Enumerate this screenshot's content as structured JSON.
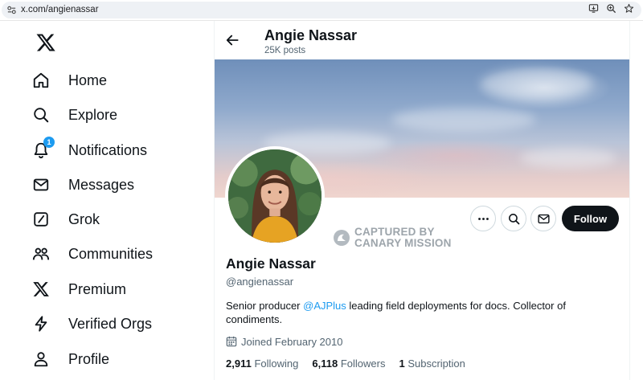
{
  "browser": {
    "url": "x.com/angienassar"
  },
  "nav": {
    "items": [
      {
        "label": "Home",
        "icon": "home-icon"
      },
      {
        "label": "Explore",
        "icon": "search-icon"
      },
      {
        "label": "Notifications",
        "icon": "bell-icon",
        "badge": "1"
      },
      {
        "label": "Messages",
        "icon": "envelope-icon"
      },
      {
        "label": "Grok",
        "icon": "grok-icon"
      },
      {
        "label": "Communities",
        "icon": "people-icon"
      },
      {
        "label": "Premium",
        "icon": "x-logo-icon"
      },
      {
        "label": "Verified Orgs",
        "icon": "lightning-icon"
      },
      {
        "label": "Profile",
        "icon": "person-icon"
      }
    ]
  },
  "header": {
    "name": "Angie Nassar",
    "posts": "25K posts"
  },
  "profile": {
    "name": "Angie Nassar",
    "handle": "@angienassar",
    "bio_before": "Senior producer ",
    "bio_mention": "@AJPlus",
    "bio_after": " leading field deployments for docs. Collector of condiments.",
    "joined": "Joined February 2010",
    "following_count": "2,911",
    "following_label": "Following",
    "followers_count": "6,118",
    "followers_label": "Followers",
    "subscription_count": "1",
    "subscription_label": "Subscription",
    "follow_label": "Follow"
  },
  "watermark": {
    "line1": "CAPTURED BY",
    "line2": "CANARY MISSION"
  },
  "colors": {
    "accent": "#1d9bf0",
    "text": "#0f1419",
    "muted": "#536471",
    "follow_bg": "#0f1419"
  }
}
